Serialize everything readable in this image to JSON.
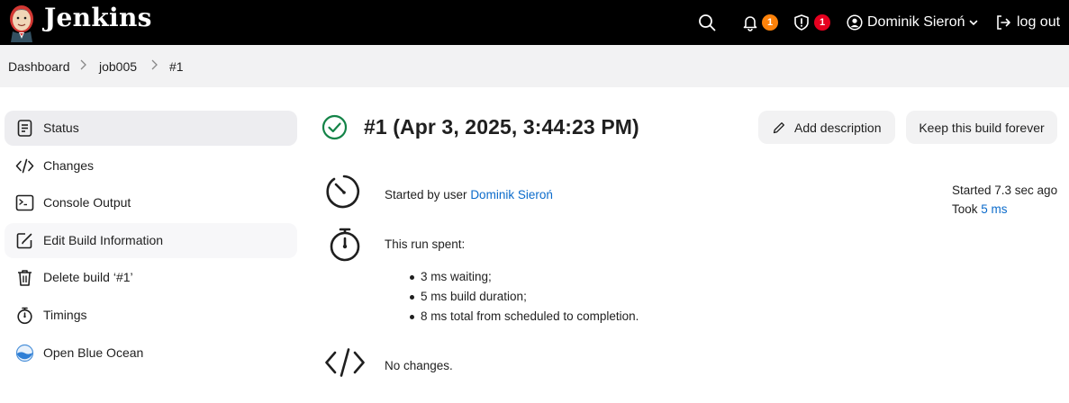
{
  "header": {
    "brand": "Jenkins",
    "logo_icon": "jenkins-butler-logo",
    "search_icon": "search-icon",
    "notifications": {
      "icon": "bell-icon",
      "count": "1",
      "color": "#fe820a"
    },
    "security": {
      "icon": "shield-icon",
      "count": "1",
      "color": "#e6001f"
    },
    "user": {
      "icon": "user-icon",
      "name": "Dominik Sieroń"
    },
    "logout": {
      "icon": "logout-icon",
      "label": "log out"
    }
  },
  "breadcrumb": {
    "items": [
      {
        "label": "Dashboard"
      },
      {
        "label": "job005"
      },
      {
        "label": "#1"
      }
    ]
  },
  "sidebar": {
    "items": [
      {
        "label": "Status",
        "icon": "document-icon",
        "active": true
      },
      {
        "label": "Changes",
        "icon": "code-icon"
      },
      {
        "label": "Console Output",
        "icon": "terminal-icon"
      },
      {
        "label": "Edit Build Information",
        "icon": "edit-icon"
      },
      {
        "label": "Delete build ‘#1’",
        "icon": "trash-icon"
      },
      {
        "label": "Timings",
        "icon": "stopwatch-icon"
      },
      {
        "label": "Open Blue Ocean",
        "icon": "blue-ocean-icon"
      }
    ]
  },
  "main": {
    "status_icon": "success-check-icon",
    "title": "#1 (Apr 3, 2025, 3:44:23 PM)",
    "buttons": {
      "add_description": "Add description",
      "keep_forever": "Keep this build forever"
    },
    "cause": {
      "prefix": "Started by user ",
      "user": "Dominik Sieroń"
    },
    "meta": {
      "started": "Started 7.3 sec ago",
      "took_prefix": "Took ",
      "took_value": "5 ms"
    },
    "timings": {
      "heading": "This run spent:",
      "items": [
        "3 ms waiting;",
        "5 ms build duration;",
        "8 ms total from scheduled to completion."
      ]
    },
    "changes": {
      "text": "No changes."
    }
  },
  "colors": {
    "accent_link": "#0b6bcb",
    "success": "#138347",
    "header_bg": "#000000"
  }
}
